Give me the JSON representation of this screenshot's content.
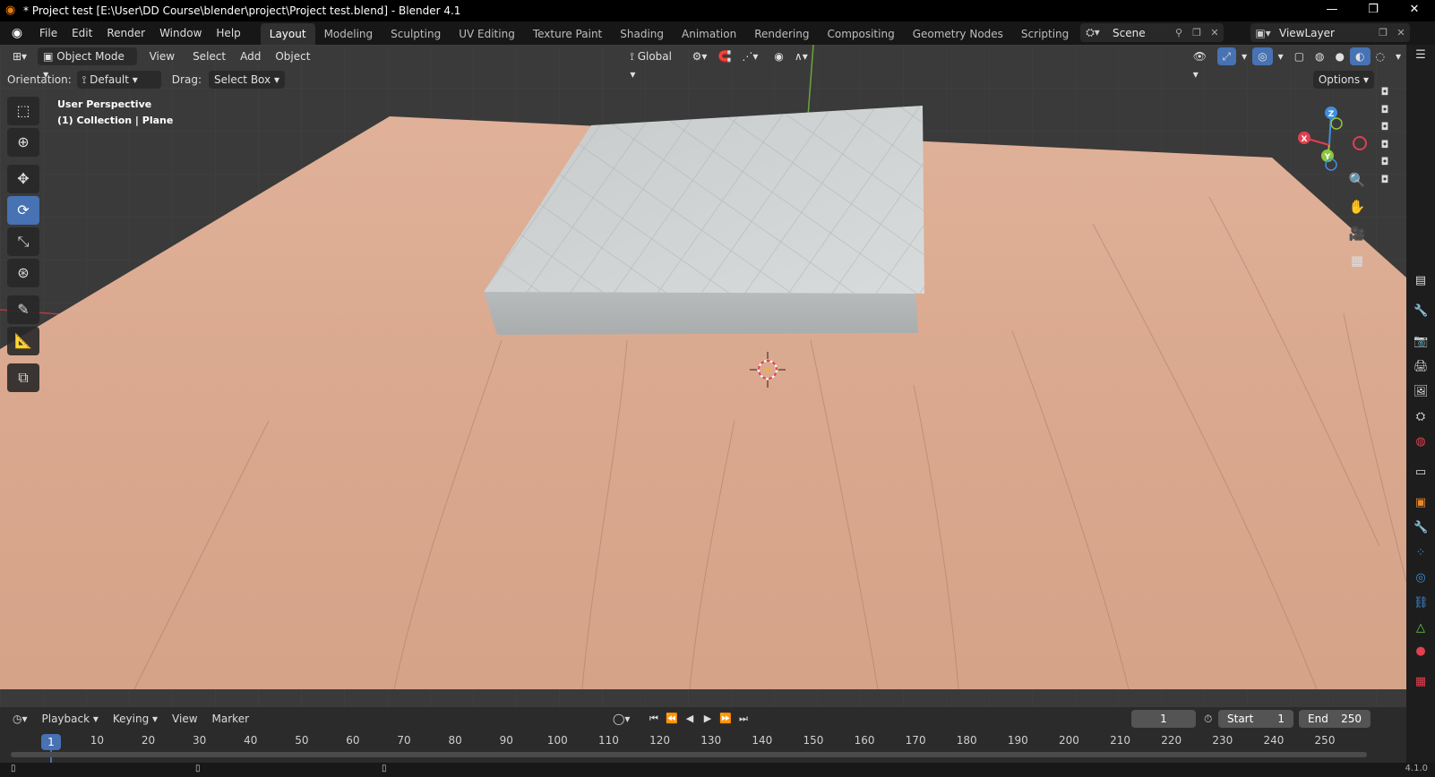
{
  "window": {
    "title": "* Project test [E:\\User\\DD Course\\blender\\project\\Project test.blend] - Blender 4.1",
    "controls": [
      "—",
      "❐",
      "✕"
    ]
  },
  "menus": [
    "File",
    "Edit",
    "Render",
    "Window",
    "Help"
  ],
  "workspaces": [
    {
      "label": "Layout",
      "active": true
    },
    {
      "label": "Modeling",
      "active": false
    },
    {
      "label": "Sculpting",
      "active": false
    },
    {
      "label": "UV Editing",
      "active": false
    },
    {
      "label": "Texture Paint",
      "active": false
    },
    {
      "label": "Shading",
      "active": false
    },
    {
      "label": "Animation",
      "active": false
    },
    {
      "label": "Rendering",
      "active": false
    },
    {
      "label": "Compositing",
      "active": false
    },
    {
      "label": "Geometry Nodes",
      "active": false
    },
    {
      "label": "Scripting",
      "active": false
    }
  ],
  "scene": {
    "name": "Scene"
  },
  "view_layer": {
    "name": "ViewLayer"
  },
  "viewport_header": {
    "mode": "Object Mode",
    "menus": [
      "View",
      "Select",
      "Add",
      "Object"
    ],
    "transform_orientation": "Global",
    "options_label": "Options"
  },
  "tool_settings": {
    "orientation_label": "Orientation:",
    "orientation_value": "Default",
    "drag_label": "Drag:",
    "drag_value": "Select Box"
  },
  "viewport_overlay": {
    "perspective": "User Perspective",
    "collection": "(1) Collection | Plane"
  },
  "gizmo": {
    "x": "X",
    "y": "Y",
    "z": "Z"
  },
  "timeline": {
    "menus": [
      "Playback",
      "Keying",
      "View",
      "Marker"
    ],
    "current_frame": "1",
    "start_label": "Start",
    "start_value": "1",
    "end_label": "End",
    "end_value": "250",
    "ruler_ticks": [
      "10",
      "20",
      "30",
      "40",
      "50",
      "60",
      "70",
      "80",
      "90",
      "100",
      "110",
      "120",
      "130",
      "140",
      "150",
      "160",
      "170",
      "180",
      "190",
      "200",
      "210",
      "220",
      "230",
      "240",
      "250"
    ],
    "playhead_label": "1"
  },
  "status": {
    "version": "4.1.0"
  },
  "colors": {
    "accent": "#4772b3",
    "floor": "#d8a78e",
    "mattress": "#c8cbcb",
    "axis_x": "#e0404f",
    "axis_y": "#8cc63f",
    "axis_z": "#3e8fe0"
  }
}
